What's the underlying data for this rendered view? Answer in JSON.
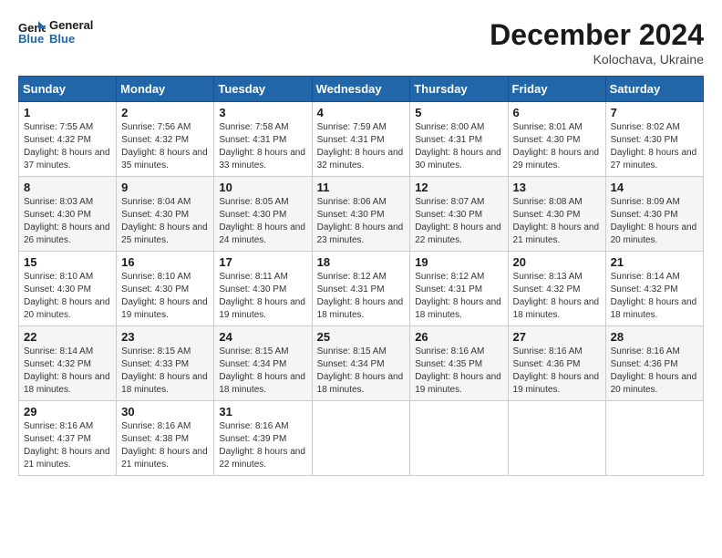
{
  "header": {
    "logo_line1": "General",
    "logo_line2": "Blue",
    "month": "December 2024",
    "location": "Kolochava, Ukraine"
  },
  "weekdays": [
    "Sunday",
    "Monday",
    "Tuesday",
    "Wednesday",
    "Thursday",
    "Friday",
    "Saturday"
  ],
  "weeks": [
    [
      {
        "day": "1",
        "sunrise": "7:55 AM",
        "sunset": "4:32 PM",
        "daylight": "8 hours and 37 minutes."
      },
      {
        "day": "2",
        "sunrise": "7:56 AM",
        "sunset": "4:32 PM",
        "daylight": "8 hours and 35 minutes."
      },
      {
        "day": "3",
        "sunrise": "7:58 AM",
        "sunset": "4:31 PM",
        "daylight": "8 hours and 33 minutes."
      },
      {
        "day": "4",
        "sunrise": "7:59 AM",
        "sunset": "4:31 PM",
        "daylight": "8 hours and 32 minutes."
      },
      {
        "day": "5",
        "sunrise": "8:00 AM",
        "sunset": "4:31 PM",
        "daylight": "8 hours and 30 minutes."
      },
      {
        "day": "6",
        "sunrise": "8:01 AM",
        "sunset": "4:30 PM",
        "daylight": "8 hours and 29 minutes."
      },
      {
        "day": "7",
        "sunrise": "8:02 AM",
        "sunset": "4:30 PM",
        "daylight": "8 hours and 27 minutes."
      }
    ],
    [
      {
        "day": "8",
        "sunrise": "8:03 AM",
        "sunset": "4:30 PM",
        "daylight": "8 hours and 26 minutes."
      },
      {
        "day": "9",
        "sunrise": "8:04 AM",
        "sunset": "4:30 PM",
        "daylight": "8 hours and 25 minutes."
      },
      {
        "day": "10",
        "sunrise": "8:05 AM",
        "sunset": "4:30 PM",
        "daylight": "8 hours and 24 minutes."
      },
      {
        "day": "11",
        "sunrise": "8:06 AM",
        "sunset": "4:30 PM",
        "daylight": "8 hours and 23 minutes."
      },
      {
        "day": "12",
        "sunrise": "8:07 AM",
        "sunset": "4:30 PM",
        "daylight": "8 hours and 22 minutes."
      },
      {
        "day": "13",
        "sunrise": "8:08 AM",
        "sunset": "4:30 PM",
        "daylight": "8 hours and 21 minutes."
      },
      {
        "day": "14",
        "sunrise": "8:09 AM",
        "sunset": "4:30 PM",
        "daylight": "8 hours and 20 minutes."
      }
    ],
    [
      {
        "day": "15",
        "sunrise": "8:10 AM",
        "sunset": "4:30 PM",
        "daylight": "8 hours and 20 minutes."
      },
      {
        "day": "16",
        "sunrise": "8:10 AM",
        "sunset": "4:30 PM",
        "daylight": "8 hours and 19 minutes."
      },
      {
        "day": "17",
        "sunrise": "8:11 AM",
        "sunset": "4:30 PM",
        "daylight": "8 hours and 19 minutes."
      },
      {
        "day": "18",
        "sunrise": "8:12 AM",
        "sunset": "4:31 PM",
        "daylight": "8 hours and 18 minutes."
      },
      {
        "day": "19",
        "sunrise": "8:12 AM",
        "sunset": "4:31 PM",
        "daylight": "8 hours and 18 minutes."
      },
      {
        "day": "20",
        "sunrise": "8:13 AM",
        "sunset": "4:32 PM",
        "daylight": "8 hours and 18 minutes."
      },
      {
        "day": "21",
        "sunrise": "8:14 AM",
        "sunset": "4:32 PM",
        "daylight": "8 hours and 18 minutes."
      }
    ],
    [
      {
        "day": "22",
        "sunrise": "8:14 AM",
        "sunset": "4:32 PM",
        "daylight": "8 hours and 18 minutes."
      },
      {
        "day": "23",
        "sunrise": "8:15 AM",
        "sunset": "4:33 PM",
        "daylight": "8 hours and 18 minutes."
      },
      {
        "day": "24",
        "sunrise": "8:15 AM",
        "sunset": "4:34 PM",
        "daylight": "8 hours and 18 minutes."
      },
      {
        "day": "25",
        "sunrise": "8:15 AM",
        "sunset": "4:34 PM",
        "daylight": "8 hours and 18 minutes."
      },
      {
        "day": "26",
        "sunrise": "8:16 AM",
        "sunset": "4:35 PM",
        "daylight": "8 hours and 19 minutes."
      },
      {
        "day": "27",
        "sunrise": "8:16 AM",
        "sunset": "4:36 PM",
        "daylight": "8 hours and 19 minutes."
      },
      {
        "day": "28",
        "sunrise": "8:16 AM",
        "sunset": "4:36 PM",
        "daylight": "8 hours and 20 minutes."
      }
    ],
    [
      {
        "day": "29",
        "sunrise": "8:16 AM",
        "sunset": "4:37 PM",
        "daylight": "8 hours and 21 minutes."
      },
      {
        "day": "30",
        "sunrise": "8:16 AM",
        "sunset": "4:38 PM",
        "daylight": "8 hours and 21 minutes."
      },
      {
        "day": "31",
        "sunrise": "8:16 AM",
        "sunset": "4:39 PM",
        "daylight": "8 hours and 22 minutes."
      },
      null,
      null,
      null,
      null
    ]
  ]
}
